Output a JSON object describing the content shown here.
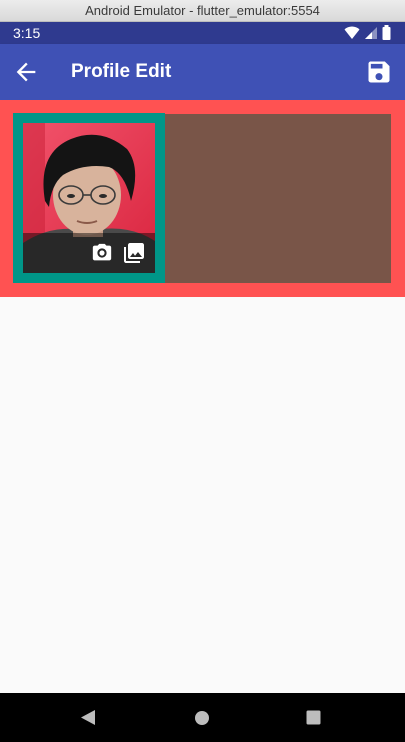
{
  "window": {
    "title": "Android Emulator - flutter_emulator:5554"
  },
  "status_bar": {
    "time": "3:15",
    "icons": [
      "wifi-icon",
      "signal-icon",
      "battery-icon"
    ]
  },
  "app_bar": {
    "title": "Profile Edit",
    "leading_icon": "arrow-back-icon",
    "action_icon": "save-icon",
    "color": "#3f51b5"
  },
  "profile": {
    "header_color": "#ff5252",
    "avatar_frame_color": "#009688",
    "info_area_color": "#795548",
    "avatar_actions": [
      "camera-icon",
      "photo-library-icon"
    ]
  },
  "nav_bar": {
    "buttons": [
      "nav-back-icon",
      "nav-home-icon",
      "nav-recents-icon"
    ]
  }
}
